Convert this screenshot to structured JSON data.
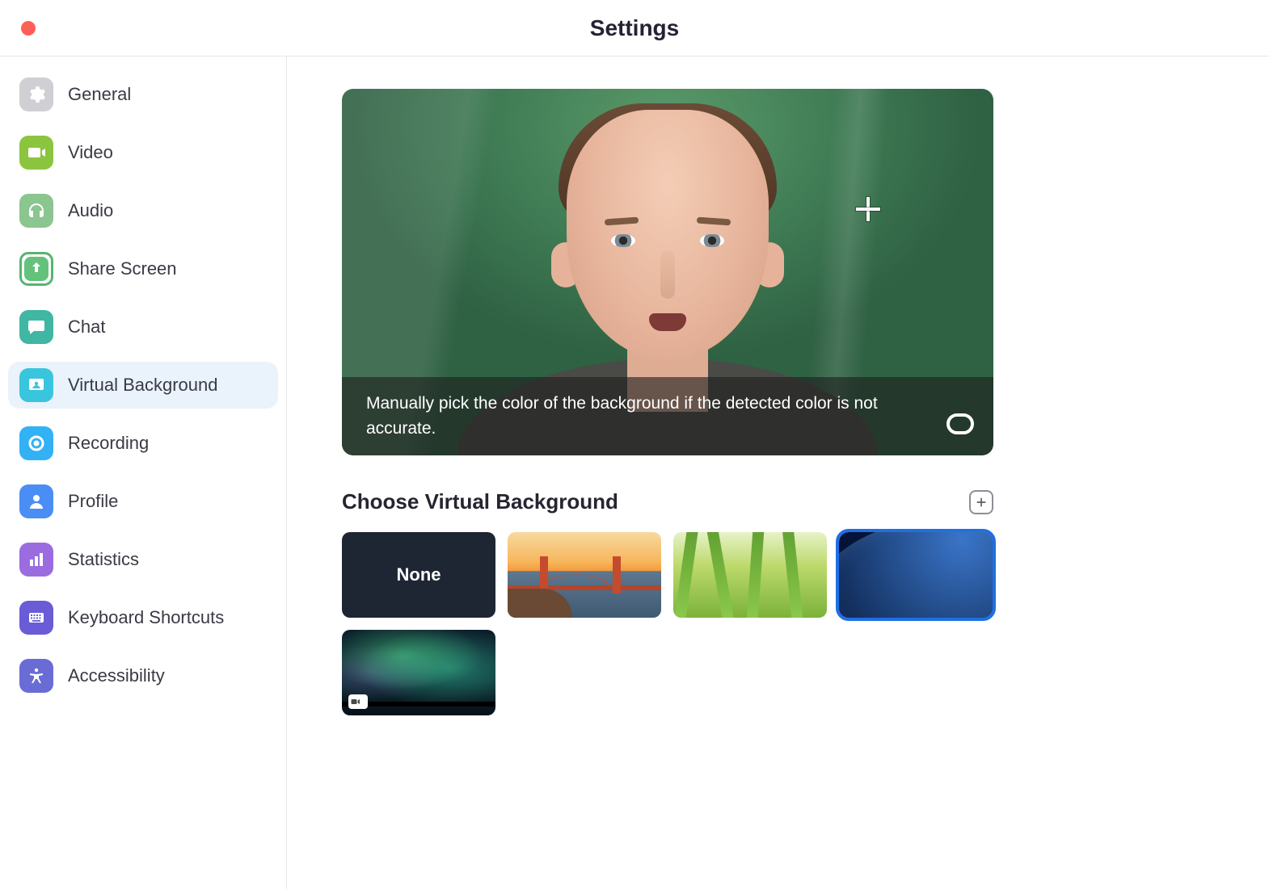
{
  "window": {
    "title": "Settings"
  },
  "sidebar": {
    "items": [
      {
        "id": "general",
        "label": "General",
        "icon": "gear-icon"
      },
      {
        "id": "video",
        "label": "Video",
        "icon": "video-icon"
      },
      {
        "id": "audio",
        "label": "Audio",
        "icon": "headphones-icon"
      },
      {
        "id": "share",
        "label": "Share Screen",
        "icon": "share-screen-icon"
      },
      {
        "id": "chat",
        "label": "Chat",
        "icon": "chat-icon"
      },
      {
        "id": "vbg",
        "label": "Virtual Background",
        "icon": "virtual-background-icon"
      },
      {
        "id": "recording",
        "label": "Recording",
        "icon": "record-icon"
      },
      {
        "id": "profile",
        "label": "Profile",
        "icon": "profile-icon"
      },
      {
        "id": "stats",
        "label": "Statistics",
        "icon": "statistics-icon"
      },
      {
        "id": "keyboard",
        "label": "Keyboard Shortcuts",
        "icon": "keyboard-icon"
      },
      {
        "id": "access",
        "label": "Accessibility",
        "icon": "accessibility-icon"
      }
    ],
    "active_id": "vbg"
  },
  "main": {
    "preview": {
      "hint_text": "Manually pick the color of the background if the detected color is not accurate."
    },
    "section_title": "Choose Virtual Background",
    "backgrounds": [
      {
        "id": "none",
        "label": "None",
        "is_video": false
      },
      {
        "id": "bridge",
        "label": "Golden Gate Bridge",
        "is_video": false
      },
      {
        "id": "grass",
        "label": "Grass",
        "is_video": false
      },
      {
        "id": "earth",
        "label": "Earth from Space",
        "is_video": false
      },
      {
        "id": "aurora",
        "label": "Northern Lights",
        "is_video": true
      }
    ],
    "selected_background_id": "earth"
  },
  "colors": {
    "selection_blue": "#1f6fe5",
    "sidebar_active_bg": "#eaf3fb"
  }
}
